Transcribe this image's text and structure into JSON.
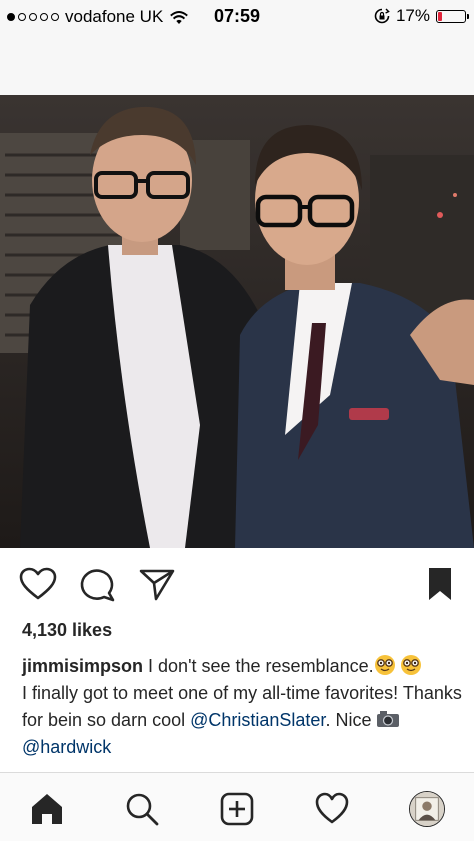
{
  "status_bar": {
    "carrier": "vodafone UK",
    "time": "07:59",
    "battery_percent": "17%",
    "battery_level": 0.17,
    "signal_strength": 1
  },
  "post": {
    "likes": "4,130 likes",
    "username": "jimmisimpson",
    "caption_line1": " I don't see the resemblance.",
    "caption_line2": "I finally got to meet one of my all-time favorites! Thanks for bein so darn cool ",
    "mention1": "@ChristianSlater",
    "caption_line3": ". Nice ",
    "mention2": "@hardwick"
  },
  "icons": {
    "like": "heart-icon",
    "comment": "comment-icon",
    "share": "share-icon",
    "save": "bookmark-icon",
    "home": "home-icon",
    "search": "search-icon",
    "new_post": "add-post-icon",
    "activity": "heart-icon",
    "profile": "avatar"
  },
  "colors": {
    "text": "#262626",
    "mention": "#003569",
    "battery_low": "#e0243a"
  }
}
